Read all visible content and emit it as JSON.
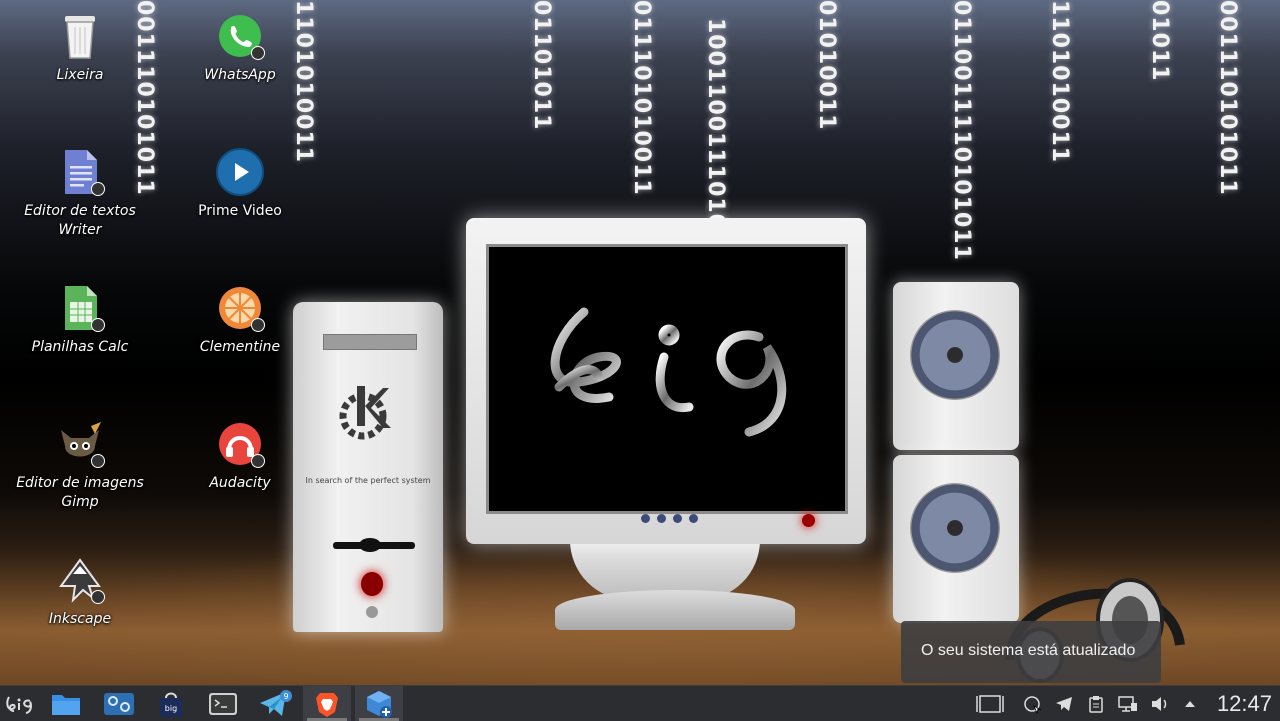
{
  "desktop": {
    "binary_streams": [
      "001110101011",
      "1101010011",
      "01101011",
      "011101010011",
      "10011001110101",
      "01010011",
      "0110011110101011",
      "1101010011",
      "01011",
      "001110101011"
    ],
    "tower_label": "In search of the perfect system",
    "icons": [
      {
        "label": "Lixeira",
        "icon": "trash-icon"
      },
      {
        "label": "WhatsApp",
        "icon": "whatsapp-icon"
      },
      {
        "label": "Editor de textos Writer",
        "icon": "writer-document-icon"
      },
      {
        "label": "Prime Video",
        "icon": "prime-video-icon"
      },
      {
        "label": "Planilhas Calc",
        "icon": "calc-spreadsheet-icon"
      },
      {
        "label": "Clementine",
        "icon": "clementine-icon"
      },
      {
        "label": "Editor de imagens Gimp",
        "icon": "gimp-icon"
      },
      {
        "label": "Audacity",
        "icon": "audacity-icon"
      },
      {
        "label": "Inkscape",
        "icon": "inkscape-icon"
      }
    ]
  },
  "notification": {
    "text": "O seu sistema está atualizado"
  },
  "taskbar": {
    "launcher": "big-launcher-icon",
    "apps": [
      {
        "name": "file-manager-icon",
        "active": false
      },
      {
        "name": "big-control-center-icon",
        "active": false
      },
      {
        "name": "big-store-icon",
        "active": false
      },
      {
        "name": "terminal-icon",
        "active": false
      },
      {
        "name": "telegram-icon",
        "active": false,
        "badge": "9"
      },
      {
        "name": "brave-browser-icon",
        "active": true
      },
      {
        "name": "package-installer-icon",
        "active": true
      }
    ],
    "tray": [
      "show-desktop-icon",
      "update-status-icon",
      "telegram-tray-icon",
      "clipboard-icon",
      "network-icon",
      "volume-icon",
      "tray-expand-icon"
    ],
    "clock": "12:47"
  },
  "colors": {
    "taskbar": "#2c2d30",
    "notification_bg": "#3e3e40",
    "power_led": "#9a0000"
  }
}
